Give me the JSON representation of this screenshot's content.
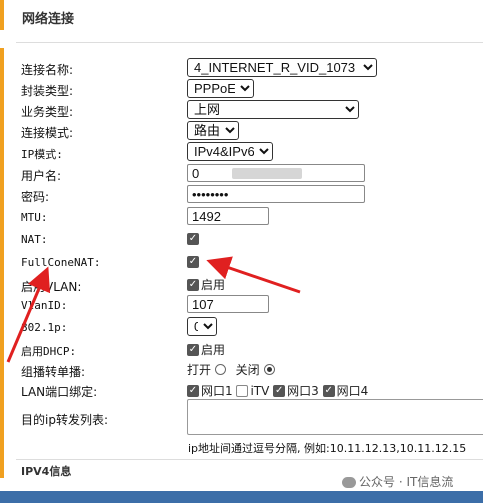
{
  "section": {
    "title": "网络连接"
  },
  "form": {
    "connection_name": {
      "label": "连接名称:",
      "value": "4_INTERNET_R_VID_1073"
    },
    "encapsulation": {
      "label": "封装类型:",
      "value": "PPPoE"
    },
    "service_type": {
      "label": "业务类型:",
      "value": "上网"
    },
    "connection_mode": {
      "label": "连接模式:",
      "value": "路由"
    },
    "ip_mode": {
      "label": "IP模式:",
      "value": "IPv4&IPv6"
    },
    "username": {
      "label": "用户名:",
      "value": "0"
    },
    "password": {
      "label": "密码:",
      "value": "••••••••"
    },
    "mtu": {
      "label": "MTU:",
      "value": "1492"
    },
    "nat": {
      "label": "NAT:",
      "checked": true
    },
    "fullcone_nat": {
      "label": "FullConeNAT:",
      "checked": true
    },
    "vlan_enable": {
      "label": "启用VLAN:",
      "option_label": "启用",
      "checked": true
    },
    "vlan_id": {
      "label": "VlanID:",
      "value": "107"
    },
    "priority": {
      "label": "802.1p:",
      "value": "0"
    },
    "dhcp_enable": {
      "label": "启用DHCP:",
      "option_label": "启用",
      "checked": true
    },
    "multicast": {
      "label": "组播转单播:",
      "on_label": "打开",
      "off_label": "关闭",
      "selected": "off"
    },
    "lan_binding": {
      "label": "LAN端口绑定:",
      "ports": [
        {
          "label": "网口1",
          "checked": true
        },
        {
          "label": "iTV",
          "checked": false
        },
        {
          "label": "网口3",
          "checked": true
        },
        {
          "label": "网口4",
          "checked": true
        }
      ]
    },
    "ip_forward_list": {
      "label": "目的ip转发列表:",
      "hint": "ip地址间通过逗号分隔, 例如:10.11.12.13,10.11.12.15"
    }
  },
  "ipv4_section": {
    "title": "IPV4信息"
  },
  "watermark": {
    "text": "公众号 · IT信息流"
  },
  "colors": {
    "accent": "#f0a020",
    "arrow": "#e02020",
    "footer": "#3c6ea8"
  }
}
